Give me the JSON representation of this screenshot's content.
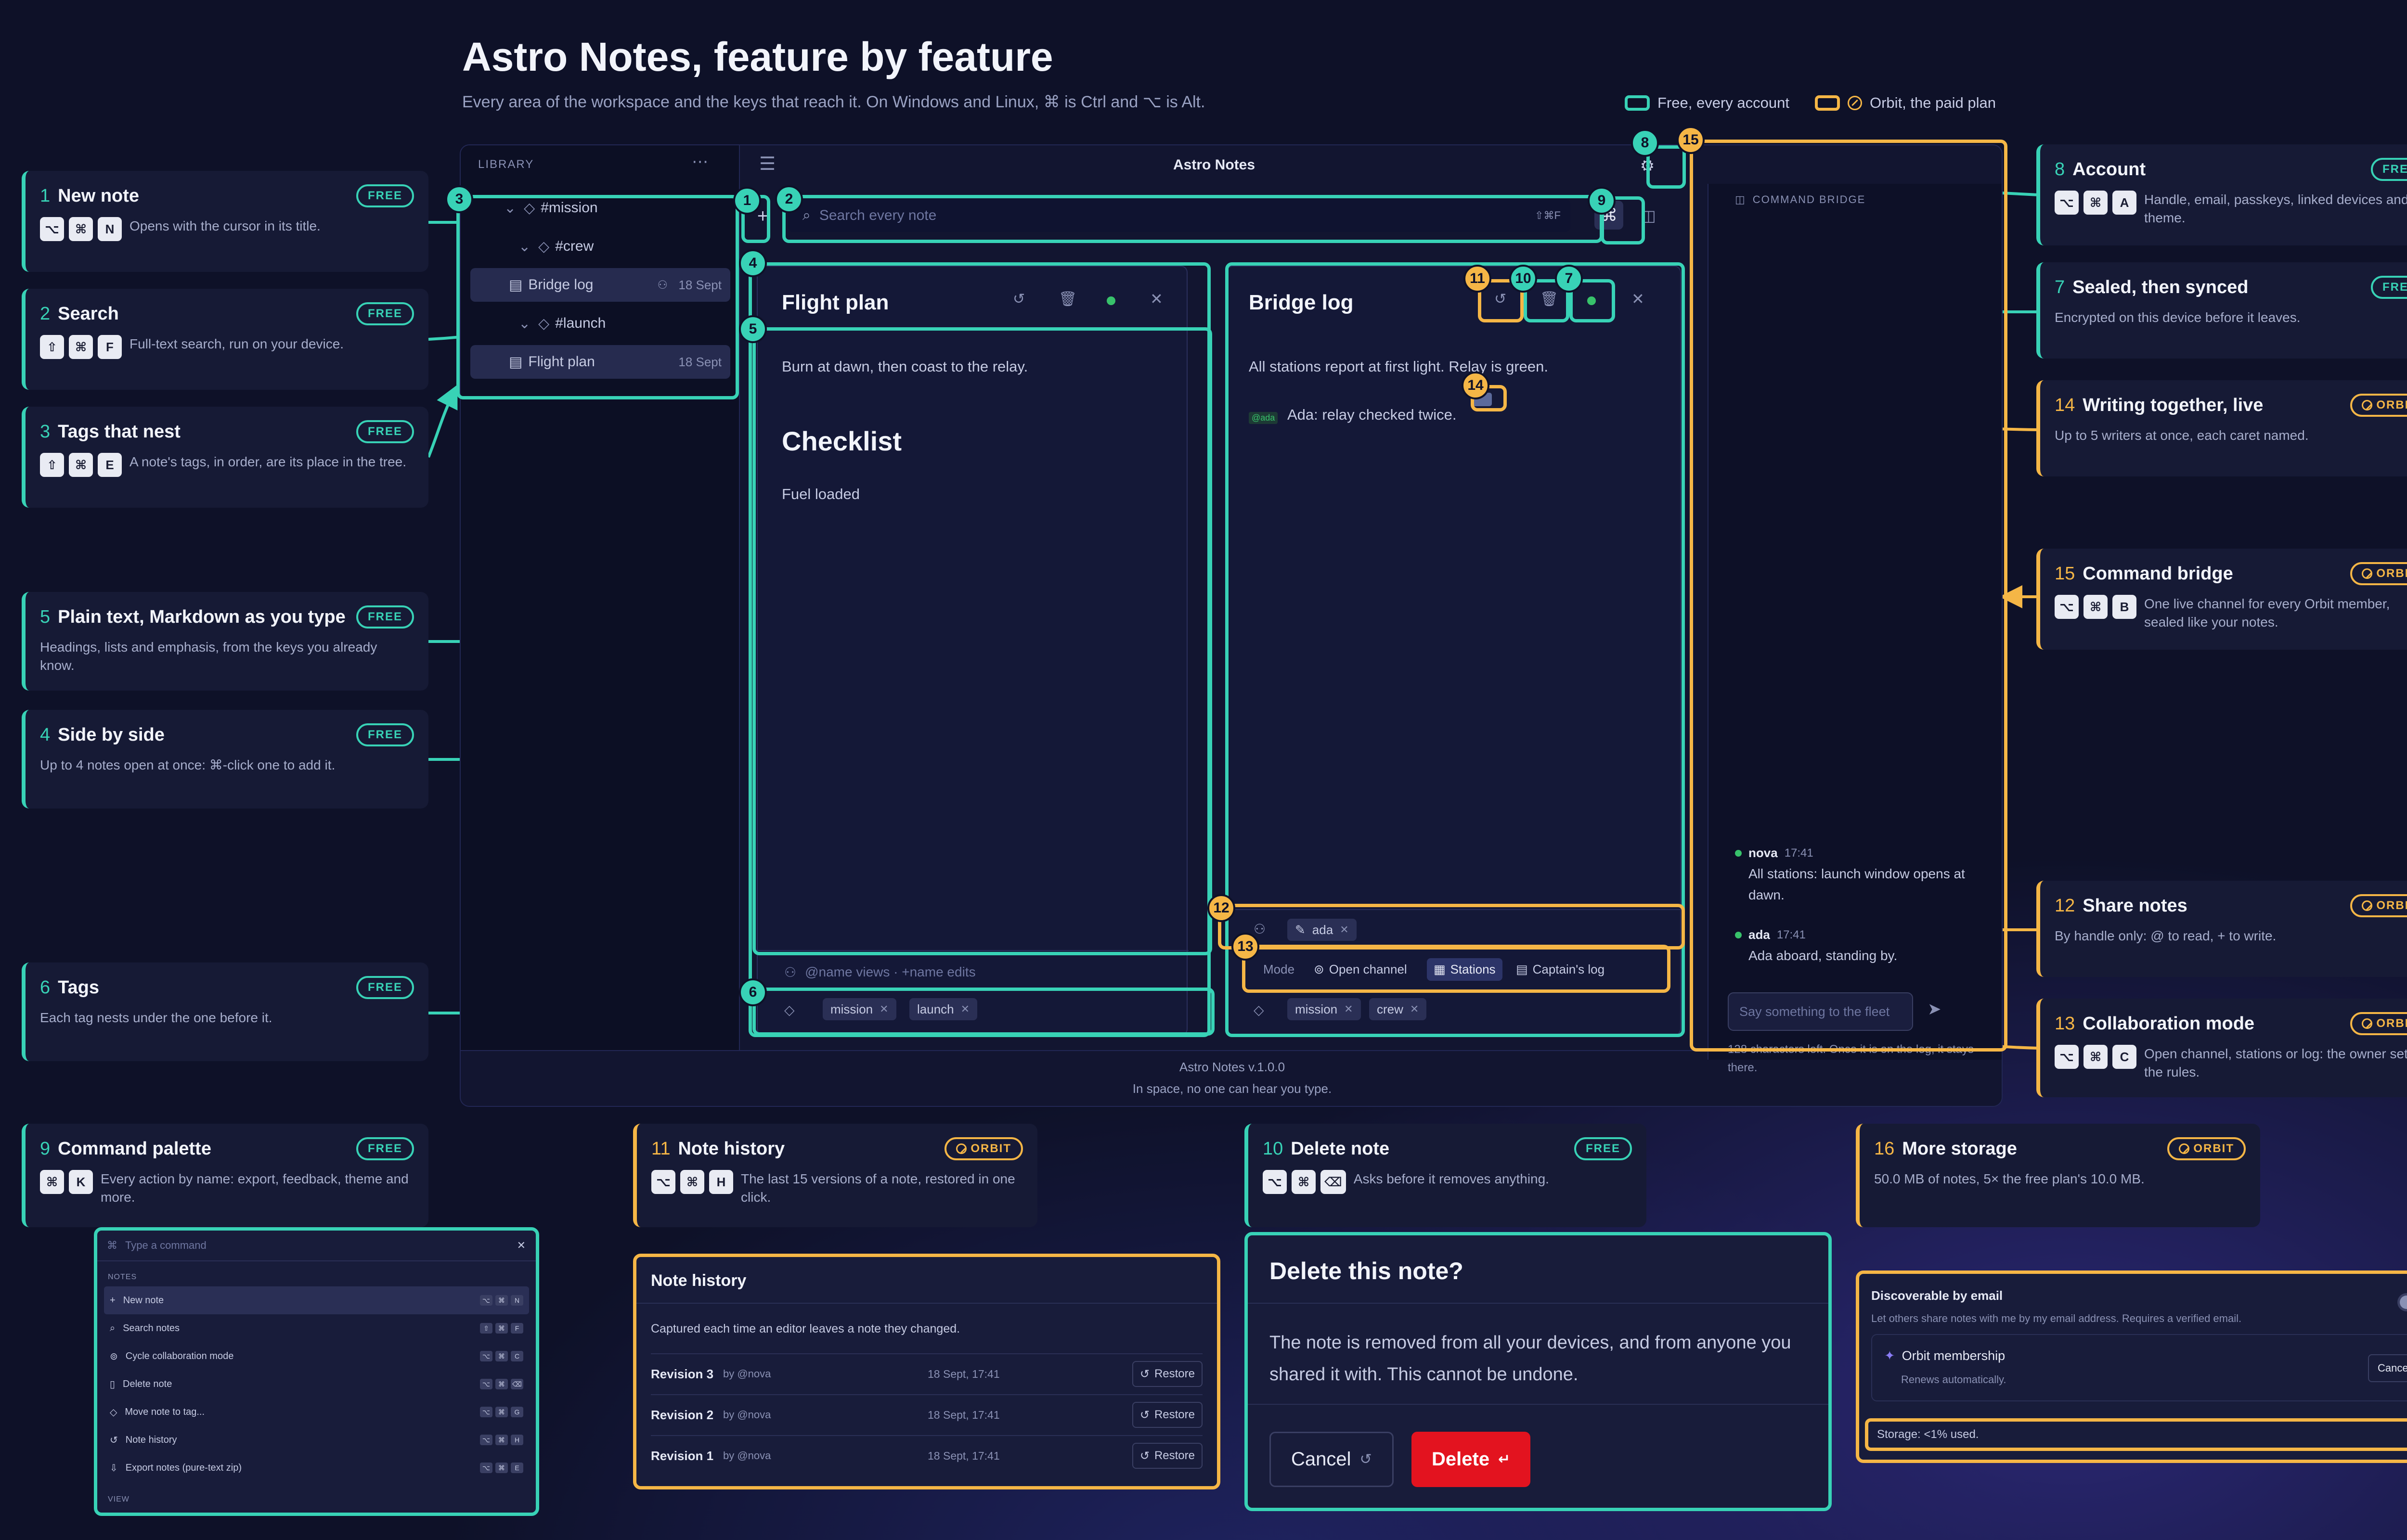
{
  "header": {
    "title": "Astro Notes, feature by feature",
    "subtitle": "Every area of the workspace and the keys that reach it. On Windows and Linux, ⌘ is Ctrl and ⌥ is Alt.",
    "legend_free": "Free, every account",
    "legend_orbit": "Orbit, the paid plan"
  },
  "colors": {
    "free": "#38d2b6",
    "orbit": "#f5b646",
    "background": "#0e1128",
    "delete": "#e3131f"
  },
  "badges": {
    "free": "FREE",
    "orbit": "ORBIT"
  },
  "cards": {
    "c1": {
      "num": "1",
      "title": "New note",
      "keys": [
        "⌥",
        "⌘",
        "N"
      ],
      "desc": "Opens with the cursor in its title."
    },
    "c2": {
      "num": "2",
      "title": "Search",
      "keys": [
        "⇧",
        "⌘",
        "F"
      ],
      "desc": "Full-text search, run on your device."
    },
    "c3": {
      "num": "3",
      "title": "Tags that nest",
      "keys": [
        "⇧",
        "⌘",
        "E"
      ],
      "desc": "A note's tags, in order, are its place in the tree."
    },
    "c5": {
      "num": "5",
      "title": "Plain text, Markdown as you type",
      "desc": "Headings, lists and emphasis, from the keys you already know."
    },
    "c4": {
      "num": "4",
      "title": "Side by side",
      "desc": "Up to 4 notes open at once: ⌘-click one to add it."
    },
    "c6": {
      "num": "6",
      "title": "Tags",
      "desc": "Each tag nests under the one before it."
    },
    "c9": {
      "num": "9",
      "title": "Command palette",
      "keys": [
        "⌘",
        "K"
      ],
      "desc": "Every action by name: export, feedback, theme and more."
    },
    "c11": {
      "num": "11",
      "title": "Note history",
      "keys": [
        "⌥",
        "⌘",
        "H"
      ],
      "desc": "The last 15 versions of a note, restored in one click."
    },
    "c10": {
      "num": "10",
      "title": "Delete note",
      "keys": [
        "⌥",
        "⌘",
        "⌫"
      ],
      "desc": "Asks before it removes anything."
    },
    "c16": {
      "num": "16",
      "title": "More storage",
      "desc": "50.0 MB of notes, 5× the free plan's 10.0 MB."
    },
    "c8": {
      "num": "8",
      "title": "Account",
      "keys": [
        "⌥",
        "⌘",
        "A"
      ],
      "desc": "Handle, email, passkeys, linked devices and theme."
    },
    "c7": {
      "num": "7",
      "title": "Sealed, then synced",
      "desc": "Encrypted on this device before it leaves."
    },
    "c14": {
      "num": "14",
      "title": "Writing together, live",
      "desc": "Up to 5 writers at once, each caret named."
    },
    "c15": {
      "num": "15",
      "title": "Command bridge",
      "keys": [
        "⌥",
        "⌘",
        "B"
      ],
      "desc": "One live channel for every Orbit member, sealed like your notes."
    },
    "c12": {
      "num": "12",
      "title": "Share notes",
      "desc": "By handle only: @ to read, + to write."
    },
    "c13": {
      "num": "13",
      "title": "Collaboration mode",
      "keys": [
        "⌥",
        "⌘",
        "C"
      ],
      "desc": "Open channel, stations or log: the owner sets the rules."
    }
  },
  "app": {
    "library_label": "LIBRARY",
    "window_title": "Astro Notes",
    "search_placeholder": "Search every note",
    "search_hint": "⇧⌘F",
    "tree": [
      {
        "label": "#mission"
      },
      {
        "label": "#crew"
      },
      {
        "label": "Bridge log",
        "date": "18 Sept"
      },
      {
        "label": "#launch"
      },
      {
        "label": "Flight plan",
        "date": "18 Sept"
      }
    ],
    "pane1": {
      "title": "Flight plan",
      "line1": "Burn at dawn, then coast to the relay.",
      "heading": "Checklist",
      "line2": "Fuel loaded",
      "share_placeholder": "@name views · +name edits",
      "tags": [
        "mission",
        "launch"
      ]
    },
    "pane2": {
      "title": "Bridge log",
      "line1": "All stations report at first light. Relay is green.",
      "caret_label": "@ada",
      "line2": "Ada: relay checked twice.",
      "shared_with": "ada",
      "mode_label": "Mode",
      "modes": [
        "Open channel",
        "Stations",
        "Captain's log"
      ],
      "tags": [
        "mission",
        "crew"
      ]
    },
    "bridge": {
      "label": "COMMAND BRIDGE",
      "messages": [
        {
          "name": "nova",
          "time": "17:41",
          "text": "All stations: launch window opens at dawn."
        },
        {
          "name": "ada",
          "time": "17:41",
          "text": "Ada aboard, standing by."
        }
      ],
      "input_placeholder": "Say something to the fleet",
      "chars_note": "128 characters left. Once it is on the log, it stays there."
    },
    "footer_version": "Astro Notes v.1.0.0",
    "footer_tag": "In space, no one can hear you type."
  },
  "pins": [
    "1",
    "2",
    "3",
    "4",
    "5",
    "6",
    "7",
    "8",
    "9",
    "10",
    "11",
    "12",
    "13",
    "14",
    "15"
  ],
  "palette": {
    "placeholder": "Type a command",
    "section": "NOTES",
    "items": [
      {
        "label": "New note",
        "keys": [
          "⌥",
          "⌘",
          "N"
        ]
      },
      {
        "label": "Search notes",
        "keys": [
          "⇧",
          "⌘",
          "F"
        ]
      },
      {
        "label": "Cycle collaboration mode",
        "keys": [
          "⌥",
          "⌘",
          "C"
        ]
      },
      {
        "label": "Delete note",
        "keys": [
          "⌥",
          "⌘",
          "⌫"
        ]
      },
      {
        "label": "Move note to tag...",
        "keys": [
          "⌥",
          "⌘",
          "G"
        ]
      },
      {
        "label": "Note history",
        "keys": [
          "⌥",
          "⌘",
          "H"
        ]
      },
      {
        "label": "Export notes (pure-text zip)",
        "keys": [
          "⌥",
          "⌘",
          "E"
        ]
      }
    ],
    "footer_section": "VIEW"
  },
  "history": {
    "title": "Note history",
    "intro": "Captured each time an editor leaves a note they changed.",
    "restore_label": "Restore",
    "rows": [
      {
        "rev": "Revision 3",
        "by": "by @nova",
        "when": "18 Sept, 17:41"
      },
      {
        "rev": "Revision 2",
        "by": "by @nova",
        "when": "18 Sept, 17:41"
      },
      {
        "rev": "Revision 1",
        "by": "by @nova",
        "when": "18 Sept, 17:41"
      }
    ]
  },
  "delete_dialog": {
    "title": "Delete this note?",
    "body": "The note is removed from all your devices, and from anyone you shared it with. This cannot be undone.",
    "cancel": "Cancel",
    "delete": "Delete"
  },
  "account_panel": {
    "discover_title": "Discoverable by email",
    "discover_desc": "Let others share notes with me by my email address. Requires a verified email.",
    "discover_on": false,
    "membership_title": "Orbit membership",
    "membership_desc": "Renews automatically.",
    "cancel": "Cancel",
    "storage": "Storage: <1% used."
  }
}
